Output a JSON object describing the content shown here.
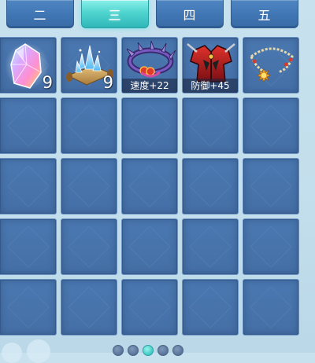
{
  "tabs": [
    {
      "label": "二",
      "active": false
    },
    {
      "label": "三",
      "active": true
    },
    {
      "label": "四",
      "active": false
    },
    {
      "label": "五",
      "active": false
    }
  ],
  "items": [
    {
      "name": "rainbow-crystal",
      "icon": "rainbow-crystal-icon",
      "quantity": "9"
    },
    {
      "name": "ice-crystal-scroll",
      "icon": "ice-crystal-scroll-icon",
      "quantity": "9"
    },
    {
      "name": "spiked-bracelet",
      "icon": "spiked-bracelet-icon",
      "stat": "速度+22"
    },
    {
      "name": "red-armor",
      "icon": "red-armor-icon",
      "stat": "防御+45"
    },
    {
      "name": "sun-pendant-necklace",
      "icon": "sun-pendant-necklace-icon"
    }
  ],
  "grid": {
    "columns": 5,
    "rows": 5
  },
  "pager": {
    "pages": 5,
    "current": 3
  },
  "colors": {
    "slot": "#4a78b0",
    "tab_inactive": "#3f74b2",
    "tab_active": "#4fd4cf",
    "background": "#c3deec"
  }
}
